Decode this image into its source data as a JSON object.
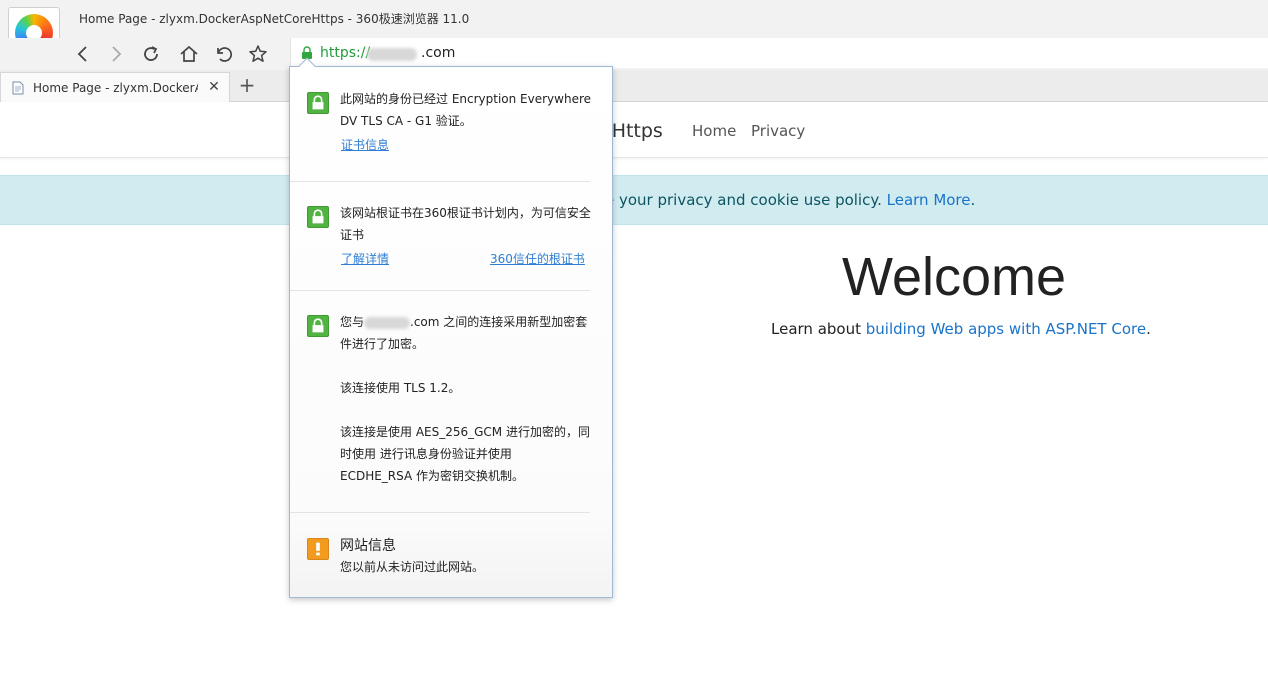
{
  "window": {
    "title": "Home Page - zlyxm.DockerAspNetCoreHttps - 360极速浏览器 11.0"
  },
  "toolbar": {
    "back_icon": "back-arrow-icon",
    "forward_icon": "forward-arrow-icon",
    "reload_icon": "reload-icon",
    "home_icon": "home-icon",
    "undo_icon": "undo-icon",
    "favorite_icon": "star-icon"
  },
  "address": {
    "protocol": "https://",
    "domain_suffix": ".com"
  },
  "tabs": [
    {
      "label": "Home Page - zlyxm.DockerA",
      "close": "✕"
    }
  ],
  "newtab": {
    "label": "+"
  },
  "site": {
    "brand_fragment": "eHttps",
    "nav": [
      {
        "label": "Home"
      },
      {
        "label": "Privacy"
      }
    ],
    "cookie": {
      "text": "e your privacy and cookie use policy. ",
      "link": "Learn More",
      "end": "."
    },
    "welcome": "Welcome",
    "learn_prefix": "Learn about ",
    "learn_link": "building Web apps with ASP.NET Core",
    "learn_suffix": "."
  },
  "popup": {
    "cert": {
      "line1": "此网站的身份已经过 Encryption Everywhere",
      "line2": "DV TLS CA - G1 验证。",
      "link": "证书信息"
    },
    "root": {
      "line1": "该网站根证书在360根证书计划内，为可信安全",
      "line2": "证书",
      "link_left": "了解详情",
      "link_right": "360信任的根证书"
    },
    "connection": {
      "line1_prefix": "您与",
      "line1_suffix": ".com 之间的连接采用新型加密套",
      "line2": "件进行了加密。",
      "line3": "该连接使用 TLS 1.2。",
      "line4": "该连接是使用 AES_256_GCM 进行加密的，同",
      "line5": "时使用  进行讯息身份验证并使用",
      "line6": "ECDHE_RSA 作为密钥交换机制。"
    },
    "siteinfo": {
      "title": "网站信息",
      "subtitle": "您以前从未访问过此网站。"
    }
  },
  "colors": {
    "secure_green": "#51b342",
    "warning_orange": "#f29b1f",
    "link_blue": "#2f7ed4",
    "cookie_bg": "#d1ecf1"
  }
}
